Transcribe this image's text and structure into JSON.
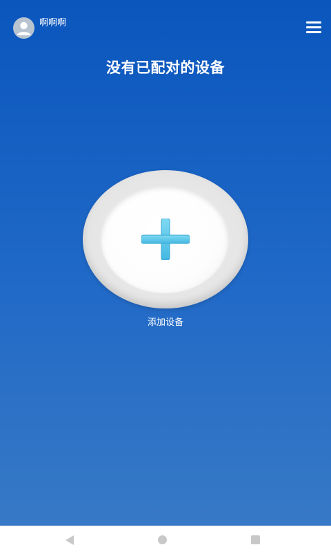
{
  "header": {
    "username": "啊啊啊",
    "avatar_icon": "user-icon",
    "menu_icon": "hamburger-menu-icon"
  },
  "main": {
    "title": "没有已配对的设备",
    "add_device_label": "添加设备",
    "add_icon": "plus-icon"
  },
  "navbar": {
    "back_icon": "back-triangle-icon",
    "home_icon": "home-circle-icon",
    "recent_icon": "recent-square-icon"
  },
  "colors": {
    "background_top": "#0a56bd",
    "background_bottom": "#3779c6",
    "plus_color": "#5cc8ea",
    "ring_color": "#e4e4e4",
    "navbar_icon_color": "#c8c8c8"
  }
}
